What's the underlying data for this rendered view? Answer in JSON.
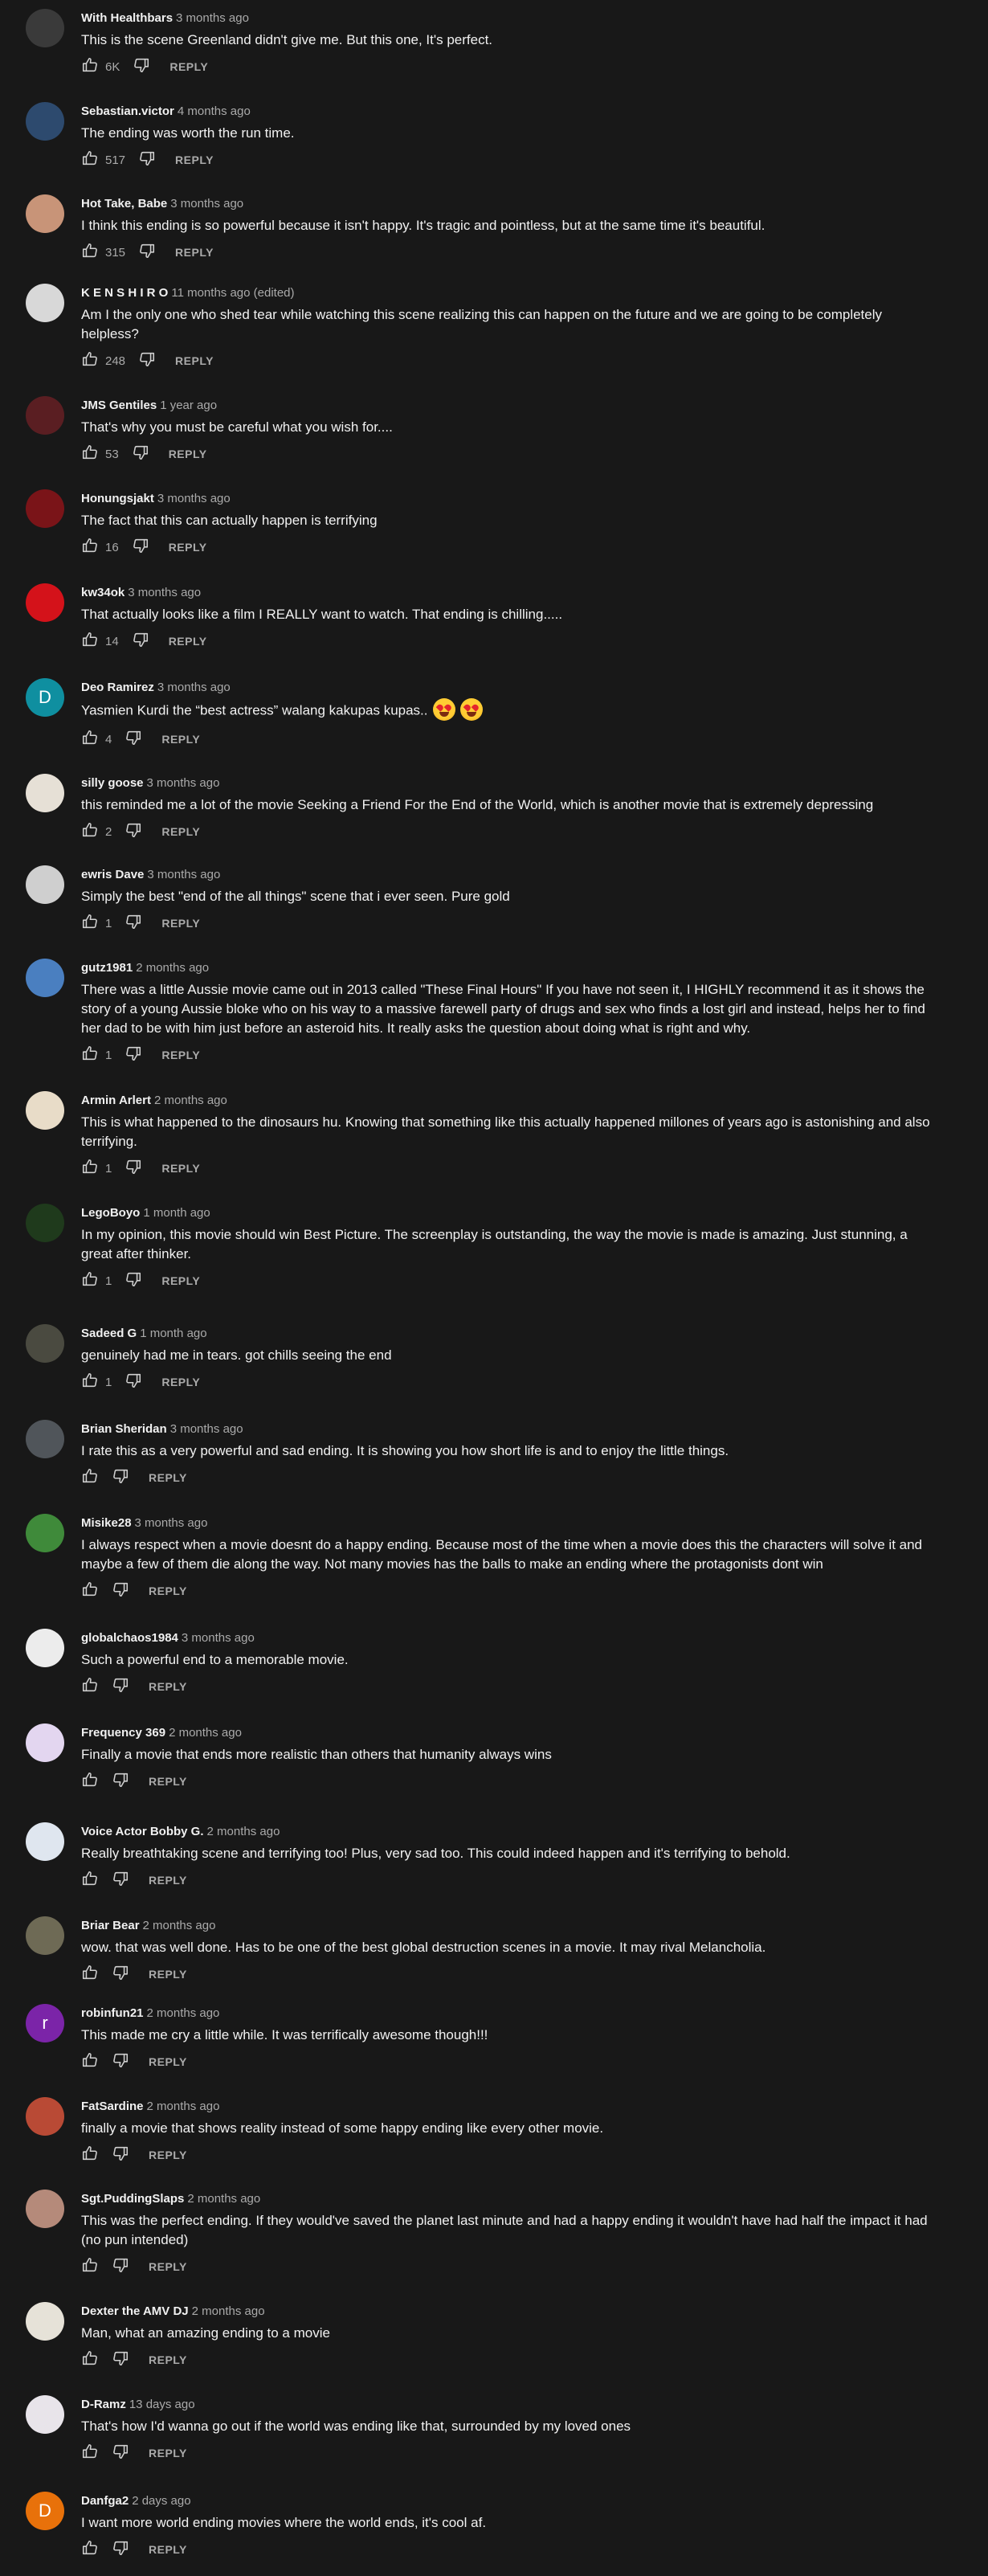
{
  "labels": {
    "reply": "REPLY"
  },
  "comments": [
    {
      "author": "With Healthbars",
      "time": "3 months ago",
      "text": "This is the scene Greenland didn't give me. But this one, It's perfect.",
      "likes": "6K",
      "avatar_color": "#3a3a3a",
      "avatar_letter": ""
    },
    {
      "author": "Sebastian.victor",
      "time": "4 months ago",
      "text": "The ending was worth the run time.",
      "likes": "517",
      "avatar_color": "#2d4a6e",
      "avatar_letter": ""
    },
    {
      "author": "Hot Take, Babe",
      "time": "3 months ago",
      "text": "I think this ending is so powerful because it isn't happy. It's tragic and pointless, but at the same time it's beautiful.",
      "likes": "315",
      "avatar_color": "#c89478",
      "avatar_letter": ""
    },
    {
      "author": "K E N S H I R O",
      "time": "11 months ago (edited)",
      "text": "Am I the only one who shed tear while watching this scene realizing this can happen on the future and we are going to be completely helpless?",
      "likes": "248",
      "avatar_color": "#d8d8d8",
      "avatar_letter": ""
    },
    {
      "author": "JMS Gentiles",
      "time": "1 year ago",
      "text": "That's why you must be careful what you wish for....",
      "likes": "53",
      "avatar_color": "#5a1e22",
      "avatar_letter": ""
    },
    {
      "author": "Honungsjakt",
      "time": "3 months ago",
      "text": "The fact that this can actually happen is terrifying",
      "likes": "16",
      "avatar_color": "#7a1418",
      "avatar_letter": ""
    },
    {
      "author": "kw34ok",
      "time": "3 months ago",
      "text": "That actually looks like a film I REALLY want to watch. That ending is chilling.....",
      "likes": "14",
      "avatar_color": "#d4121a",
      "avatar_letter": ""
    },
    {
      "author": "Deo Ramirez",
      "time": "3 months ago",
      "text": "Yasmien Kurdi the “best actress” walang kakupas kupas..",
      "likes": "4",
      "avatar_color": "#0f8fa0",
      "avatar_letter": "D",
      "emoji": true
    },
    {
      "author": "silly goose",
      "time": "3 months ago",
      "text": "this reminded me a lot of the movie Seeking a Friend For the End of the World, which is another movie that is extremely depressing",
      "likes": "2",
      "avatar_color": "#e6e0d6",
      "avatar_letter": ""
    },
    {
      "author": "ewris Dave",
      "time": "3 months ago",
      "text": "Simply the best \"end of the all things\" scene that i ever seen. Pure gold",
      "likes": "1",
      "avatar_color": "#cfcfcf",
      "avatar_letter": ""
    },
    {
      "author": "gutz1981",
      "time": "2 months ago",
      "text": "There was a little Aussie movie came out in 2013 called \"These Final Hours\" If you have not seen it, I HIGHLY recommend it as it shows the story of a young Aussie bloke who on his way to a massive farewell party of drugs and sex who finds a lost girl and instead, helps her to find her dad to be with him just before an asteroid hits. It really asks the question about doing what is right and why.",
      "likes": "1",
      "avatar_color": "#4a7fc0",
      "avatar_letter": ""
    },
    {
      "author": "Armin Arlert",
      "time": "2 months ago",
      "text": "This is what happened to the dinosaurs hu. Knowing that something like this actually happened millones of years ago is astonishing and also terrifying.",
      "likes": "1",
      "avatar_color": "#e8dcc8",
      "avatar_letter": ""
    },
    {
      "author": "LegoBoyo",
      "time": "1 month ago",
      "text": "In my opinion, this movie should win Best Picture. The screenplay is outstanding, the way the movie is made is amazing. Just stunning, a great after thinker.",
      "likes": "1",
      "avatar_color": "#1f3a1c",
      "avatar_letter": ""
    },
    {
      "author": "Sadeed G",
      "time": "1 month ago",
      "text": "genuinely had me in tears. got chills seeing the end",
      "likes": "1",
      "avatar_color": "#4a4a40",
      "avatar_letter": ""
    },
    {
      "author": "Brian Sheridan",
      "time": "3 months ago",
      "text": "I rate this as a very powerful and sad ending. It is showing you how short life is and to enjoy the little things.",
      "likes": "",
      "avatar_color": "#50555a",
      "avatar_letter": ""
    },
    {
      "author": "Misike28",
      "time": "3 months ago",
      "text": "I always respect when a movie doesnt do a happy ending. Because most of the time when a movie does this the characters will solve it and maybe a few of them die along the way. Not many movies has the balls to make an ending where the protagonists dont win",
      "likes": "",
      "avatar_color": "#3f8a3a",
      "avatar_letter": ""
    },
    {
      "author": "globalchaos1984",
      "time": "3 months ago",
      "text": "Such a powerful end to a memorable movie.",
      "likes": "",
      "avatar_color": "#ececec",
      "avatar_letter": ""
    },
    {
      "author": "Frequency 369",
      "time": "2 months ago",
      "text": "Finally a movie that ends more realistic than others that humanity always wins",
      "likes": "",
      "avatar_color": "#e3d6f0",
      "avatar_letter": ""
    },
    {
      "author": "Voice Actor Bobby G.",
      "time": "2 months ago",
      "text": "Really breathtaking scene and terrifying too! Plus, very sad too. This could indeed happen and it's terrifying to behold.",
      "likes": "",
      "avatar_color": "#dfe6ef",
      "avatar_letter": ""
    },
    {
      "author": "Briar Bear",
      "time": "2 months ago",
      "text": "wow. that was well done. Has to be one of the best global destruction scenes in a movie. It may rival Melancholia.",
      "likes": "",
      "avatar_color": "#6e6a55",
      "avatar_letter": ""
    },
    {
      "author": "robinfun21",
      "time": "2 months ago",
      "text": "This made me cry a little while. It was terrifically awesome though!!!",
      "likes": "",
      "avatar_color": "#7b24a8",
      "avatar_letter": "r"
    },
    {
      "author": "FatSardine",
      "time": "2 months ago",
      "text": "finally a movie that shows reality instead of some happy ending like every other movie.",
      "likes": "",
      "avatar_color": "#b94a35",
      "avatar_letter": ""
    },
    {
      "author": "Sgt.PuddingSlaps",
      "time": "2 months ago",
      "text": "This was the perfect ending. If they would've saved the planet last minute and had a happy ending it wouldn't have had half the impact it had (no pun intended)",
      "likes": "",
      "avatar_color": "#b58a7a",
      "avatar_letter": ""
    },
    {
      "author": "Dexter the AMV DJ",
      "time": "2 months ago",
      "text": "Man, what an amazing ending to a movie",
      "likes": "",
      "avatar_color": "#e6e2d8",
      "avatar_letter": ""
    },
    {
      "author": "D-Ramz",
      "time": "13 days ago",
      "text": "That's how I'd wanna go out if the world was ending like that, surrounded by my loved ones",
      "likes": "",
      "avatar_color": "#e8e4ea",
      "avatar_letter": ""
    },
    {
      "author": "Danfga2",
      "time": "2 days ago",
      "text": "I want more world ending movies where the world ends, it's cool af.",
      "likes": "",
      "avatar_color": "#e8710a",
      "avatar_letter": "D"
    }
  ]
}
